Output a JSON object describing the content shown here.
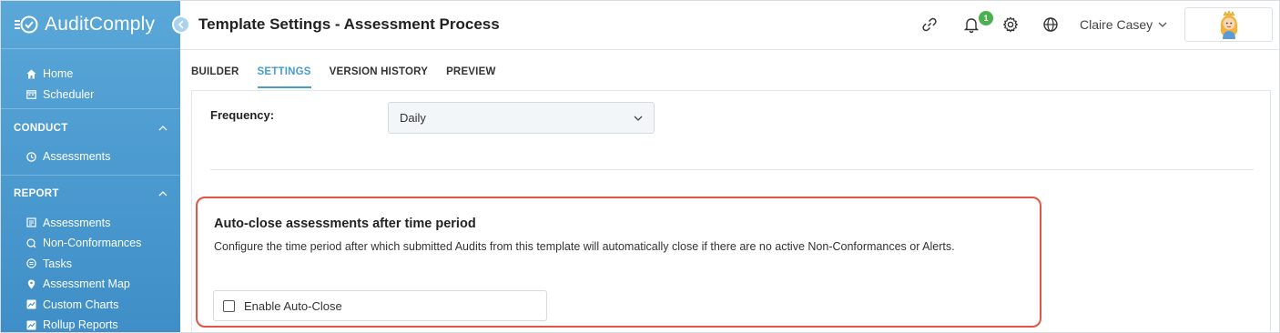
{
  "app": {
    "name": "AuditComply"
  },
  "sidebar": {
    "top_items": [
      {
        "label": "Home",
        "icon": "home-icon"
      },
      {
        "label": "Scheduler",
        "icon": "calendar-icon"
      }
    ],
    "sections": [
      {
        "title": "CONDUCT",
        "items": [
          {
            "label": "Assessments",
            "icon": "clock-icon"
          }
        ]
      },
      {
        "title": "REPORT",
        "items": [
          {
            "label": "Assessments",
            "icon": "report-icon"
          },
          {
            "label": "Non-Conformances",
            "icon": "non-conformance-icon"
          },
          {
            "label": "Tasks",
            "icon": "tasks-icon"
          },
          {
            "label": "Assessment Map",
            "icon": "map-pin-icon"
          },
          {
            "label": "Custom Charts",
            "icon": "chart-icon"
          },
          {
            "label": "Rollup Reports",
            "icon": "chart-icon"
          }
        ]
      }
    ]
  },
  "header": {
    "title": "Template Settings - Assessment Process",
    "notification_count": "1",
    "user_name": "Claire Casey"
  },
  "tabs": [
    {
      "label": "BUILDER",
      "active": false
    },
    {
      "label": "SETTINGS",
      "active": true
    },
    {
      "label": "VERSION HISTORY",
      "active": false
    },
    {
      "label": "PREVIEW",
      "active": false
    }
  ],
  "settings": {
    "frequency_label": "Frequency:",
    "frequency_value": "Daily",
    "auto_close": {
      "title": "Auto-close assessments after time period",
      "description": "Configure the time period after which submitted Audits from this template will automatically close if there are no active Non-Conformances or Alerts.",
      "checkbox_label": "Enable Auto-Close",
      "checked": false
    }
  },
  "colors": {
    "sidebar": "#4a99cf",
    "accent": "#4a9bd1",
    "highlight": "#e05545",
    "badge": "#4caf50"
  }
}
